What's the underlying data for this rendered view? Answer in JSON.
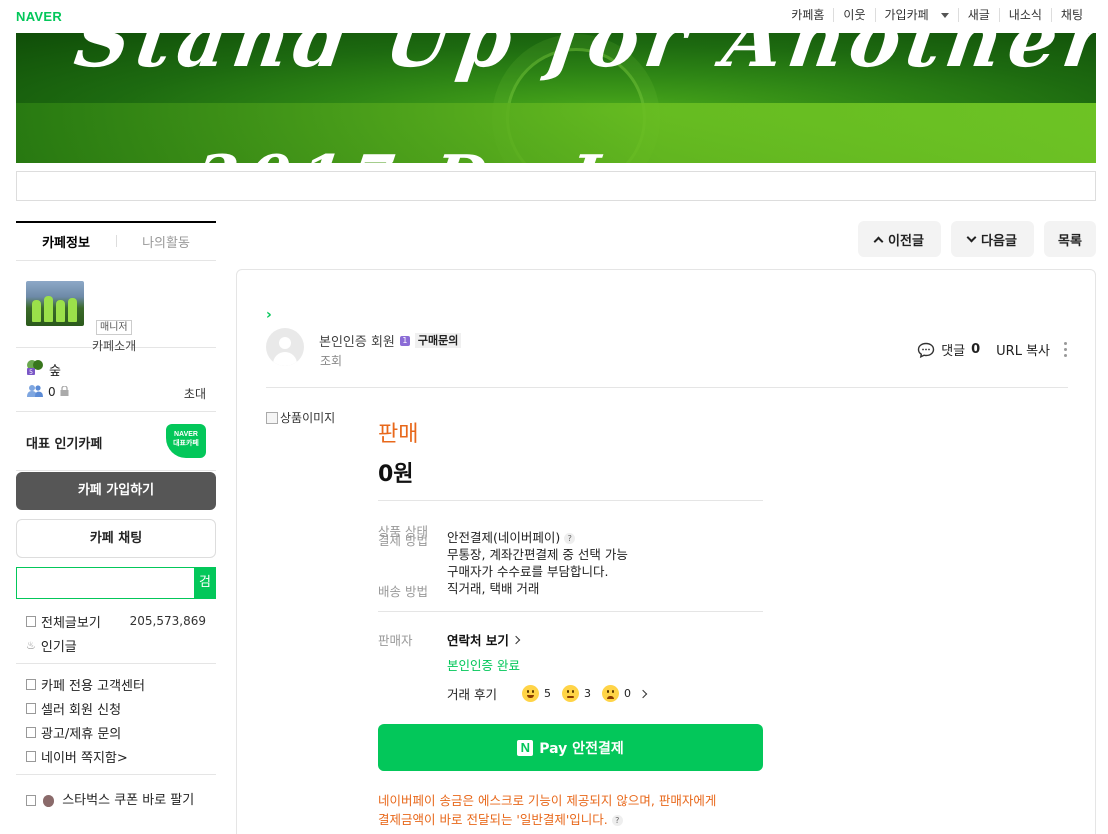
{
  "topbar": {
    "logo": "NAVER",
    "links": [
      "카페홈",
      "이웃",
      "가입카페",
      "새글",
      "내소식",
      "채팅"
    ]
  },
  "sidebar": {
    "tabs": [
      "카페정보",
      "나의활동"
    ],
    "manager_badge": "매니저",
    "cafe_intro": "카페소개",
    "level": "숲",
    "member_count": "0",
    "invite": "초대",
    "rep_label": "대표 인기카페",
    "rep_badge_line1": "NAVER",
    "rep_badge_line2": "대표카페",
    "join_button": "카페 가입하기",
    "chat_button": "카페 채팅",
    "search_button": "검색",
    "menu": {
      "all_posts": "전체글보기",
      "all_posts_count": "205,573,869",
      "popular": "인기글",
      "customer_center": "카페 전용 고객센터",
      "seller_apply": "셀러 회원 신청",
      "ads": "광고/제휴 문의",
      "naver_note": "네이버 쪽지함>",
      "starbucks": "스타벅스 쿠폰 바로 팔기"
    }
  },
  "nav": {
    "prev": "이전글",
    "next": "다음글",
    "list": "목록"
  },
  "article": {
    "author": "본인인증 회원",
    "level_badge": "1",
    "grade": "구매문의",
    "views_label": "조회",
    "comments_label": "댓글",
    "comments_count": "0",
    "url_copy": "URL 복사",
    "product_image_alt": "상품이미지",
    "sale_status": "판매",
    "price": "0원",
    "labels": {
      "product_state": "상품 상태",
      "payment_method": "결제 방법",
      "shipping": "배송 방법",
      "seller": "판매자"
    },
    "payment_lines": [
      "안전결제(네이버페이)",
      "무통장, 계좌간편결제 중 선택 가능",
      "구매자가 수수료를 부담합니다."
    ],
    "shipping_value": "직거래, 택배 거래",
    "contact": "연락처 보기",
    "verified": "본인인증 완료",
    "review_label": "거래 후기",
    "reviews": [
      "5",
      "3",
      "0"
    ],
    "pay_button": "Pay 안전결제",
    "pay_logo": "N",
    "warning_line1": "네이버페이 송금은 에스크로 기능이 제공되지 않으며, 판매자에게",
    "warning_line2": "결제금액이 바로 전달되는 '일반결제'입니다."
  },
  "colors": {
    "naver_green": "#03c75a",
    "accent_orange": "#e8681b"
  }
}
